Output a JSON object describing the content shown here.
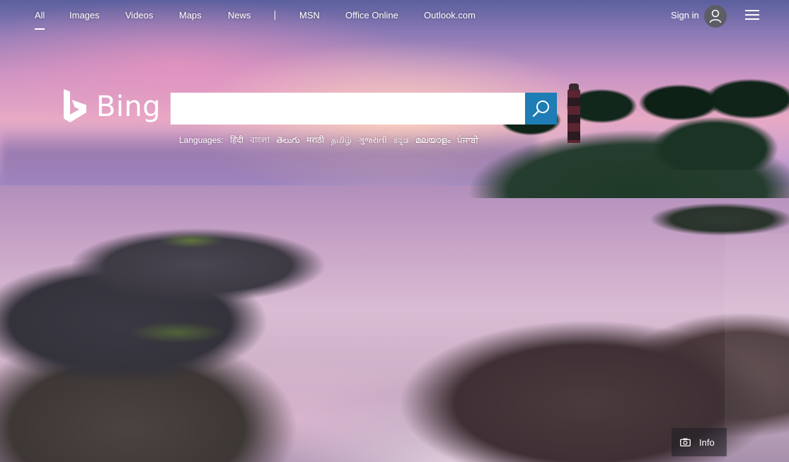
{
  "nav": {
    "items": [
      {
        "label": "All",
        "active": true
      },
      {
        "label": "Images"
      },
      {
        "label": "Videos"
      },
      {
        "label": "Maps"
      },
      {
        "label": "News"
      },
      {
        "label": "MSN"
      },
      {
        "label": "Office Online"
      },
      {
        "label": "Outlook.com"
      }
    ],
    "signin_label": "Sign in",
    "avatar_icon": "user-icon",
    "menu_icon": "hamburger-menu-icon"
  },
  "logo": {
    "text": "Bing",
    "icon": "bing-logo-icon"
  },
  "search": {
    "value": "",
    "placeholder": "",
    "button_icon": "search-icon",
    "button_color": "#1d7db4"
  },
  "languages": {
    "label": "Languages:",
    "items": [
      "हिंदी",
      "বাংলা",
      "తెలుగు",
      "मराठी",
      "தமிழ்",
      "ગુજરાતી",
      "ಕನ್ನಡ",
      "മലയാളം",
      "ਪੰਜਾਬੀ"
    ]
  },
  "info": {
    "label": "Info",
    "icon": "camera-icon"
  }
}
